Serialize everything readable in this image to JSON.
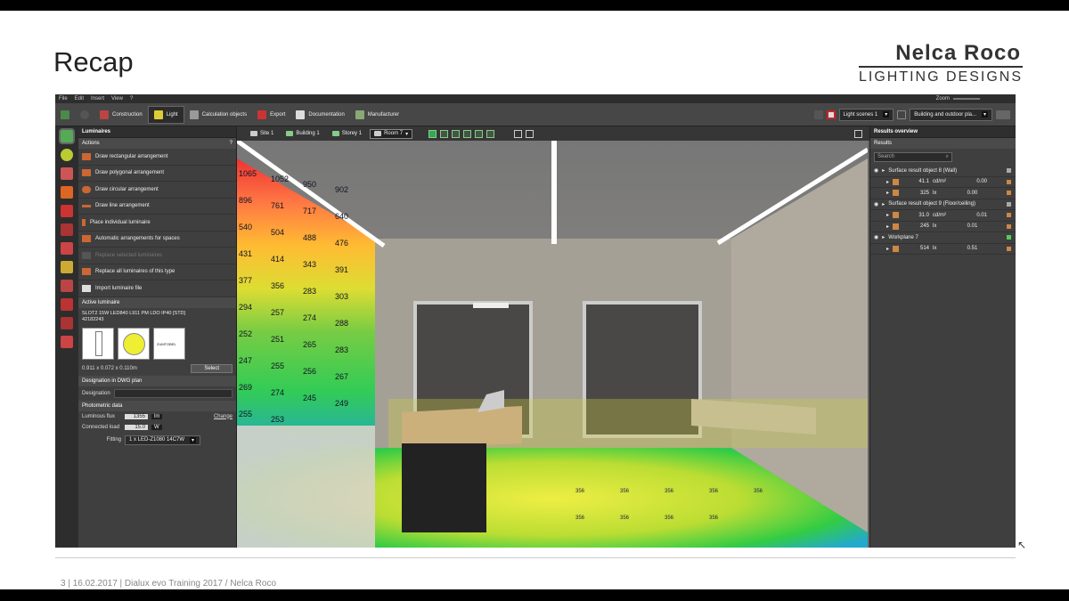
{
  "slide": {
    "title": "Recap",
    "logo_line1": "Nelca Roco",
    "logo_line2": "LIGHTING DESIGNS",
    "footer": "3  |  16.02.2017  |  Dialux evo Training 2017 / Nelca Roco"
  },
  "app": {
    "menu": [
      "File",
      "Edit",
      "Insert",
      "View",
      "?"
    ],
    "zoom_label": "Zoom",
    "toolbar": {
      "construction": "Construction",
      "light": "Light",
      "calc_objects": "Calculation objects",
      "export": "Export",
      "documentation": "Documentation",
      "manufacturer": "Manufacturer",
      "light_scenes": "Light scenes 1",
      "scene_scope": "Building and outdoor pla..."
    },
    "luminaires": {
      "header": "Luminaires",
      "actions_title": "Actions",
      "help": "?",
      "actions": [
        "Draw rectangular arrangement",
        "Draw polygonal arrangement",
        "Draw circular arrangement",
        "Draw line arrangement",
        "Place individual luminaire",
        "Automatic arrangements for spaces",
        "Replace selected luminaires",
        "Replace all luminaires of this type",
        "Import luminaire file"
      ],
      "active_title": "Active luminaire",
      "active_name": "SLOT2 15W LED840 L911 PM LDO IP40 [STD]",
      "active_code": "42182243",
      "dimensions": "0.911 x 0.072 x 0.110m",
      "select_label": "Select",
      "thumb_brand": "ZUMTOBEL",
      "designation_title": "Designation in DWG plan",
      "designation_label": "Designation",
      "photometric_title": "Photometric data",
      "flux_label": "Luminous flux",
      "flux_value": "1355",
      "flux_unit": "lm",
      "change_label": "Change",
      "load_label": "Connected load",
      "load_value": "15.0",
      "load_unit": "W",
      "fitting_label": "Fitting",
      "fitting_value": "1 x LED-Z1080 14C7W"
    },
    "viewport": {
      "crumbs": [
        "Site 1",
        "Building 1",
        "Storey 1",
        "Room 7"
      ]
    },
    "results": {
      "overview": "Results overview",
      "title": "Results",
      "search": "Search",
      "rows": [
        {
          "label": "Surface result object 8 (Wall)",
          "kind": "header"
        },
        {
          "v": "41.1",
          "u": "cd/m²",
          "r": "0.00",
          "kind": "val"
        },
        {
          "v": "325",
          "u": "lx",
          "r": "0.00",
          "kind": "val"
        },
        {
          "label": "Surface result object 9 (Floor/ceiling)",
          "kind": "header"
        },
        {
          "v": "31.0",
          "u": "cd/m²",
          "r": "0.01",
          "kind": "val"
        },
        {
          "v": "245",
          "u": "lx",
          "r": "0.01",
          "kind": "val"
        },
        {
          "label": "Workplane 7",
          "kind": "header"
        },
        {
          "v": "514",
          "u": "lx",
          "r": "0.51",
          "kind": "val"
        }
      ]
    },
    "wall_values": [
      "1065",
      "1052",
      "950",
      "902",
      "896",
      "761",
      "717",
      "640",
      "540",
      "504",
      "488",
      "476",
      "431",
      "414",
      "343",
      "391",
      "377",
      "356",
      "283",
      "303",
      "294",
      "257",
      "274",
      "288",
      "252",
      "251",
      "265",
      "283",
      "247",
      "255",
      "256",
      "267",
      "269",
      "274",
      "245",
      "249",
      "255",
      "253"
    ],
    "floor_values": [
      "356",
      "356",
      "356",
      "356",
      "356",
      "356",
      "356",
      "356",
      "356"
    ]
  }
}
